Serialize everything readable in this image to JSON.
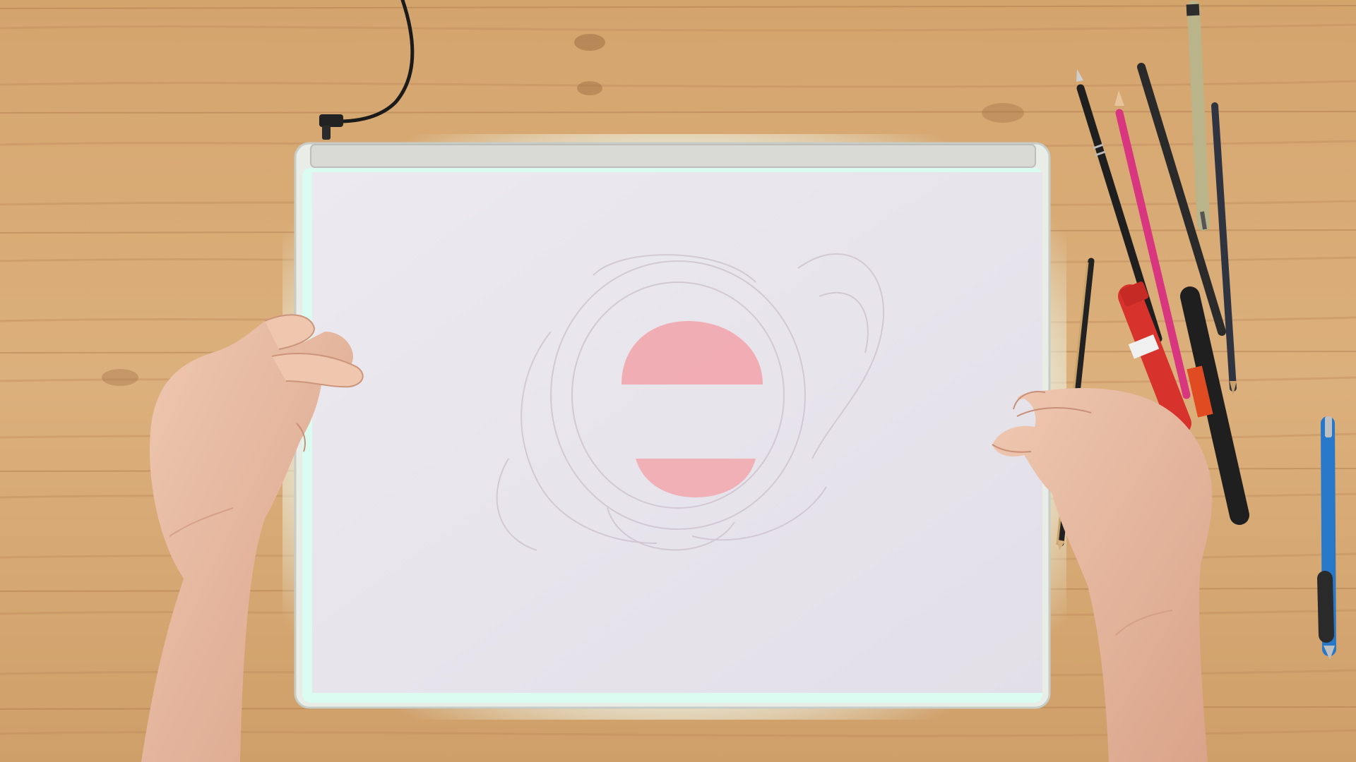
{
  "scene": {
    "description_free": true,
    "palette": {
      "wood_light": "#d9ad79",
      "wood_mid": "#c99a66",
      "wood_dark": "#a8764a",
      "lightbox_frame": "#e9eee8",
      "lightbox_glow": "#d8fff2",
      "paper": "#e9e6ee",
      "paper_shadow": "#dcd8e2",
      "sketch_line": "#cfc4cf",
      "sketch_red": "#f2a3a9",
      "skin": "#e8bca4",
      "skin_shadow": "#c98f77",
      "cable": "#1b1b1b",
      "pencil_black": "#2a2a2a",
      "pencil_magenta": "#d8377f",
      "pen_tan": "#b9b48a",
      "marker_red": "#d8322c",
      "pen_blue": "#2778c9"
    },
    "objects": [
      "light-box",
      "tracing-paper",
      "power-cable",
      "left-hand",
      "right-hand",
      "pencils",
      "markers",
      "ballpoint-pen"
    ]
  }
}
